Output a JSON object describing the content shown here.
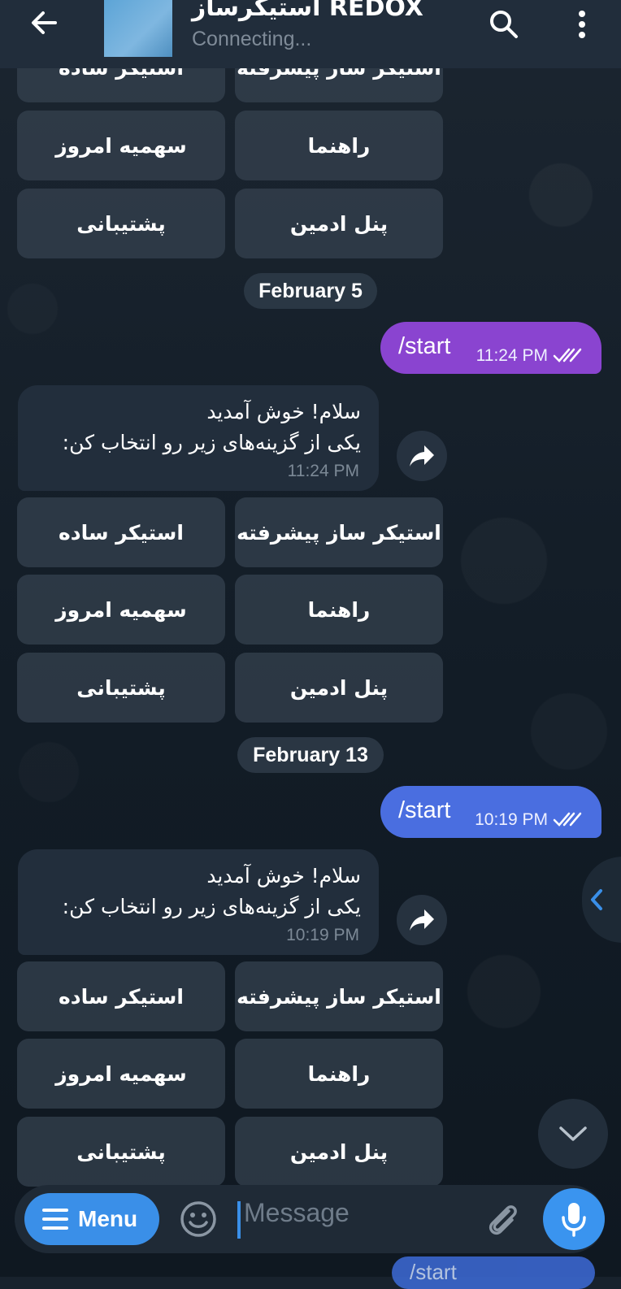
{
  "header": {
    "title": "استیکرساز REDOX",
    "status": "Connecting..."
  },
  "keyboard": {
    "advanced": "استیکر ساز پیشرفته",
    "simple": "استیکر ساده",
    "guide": "راهنما",
    "quota": "سهمیه امروز",
    "admin": "پنل ادمین",
    "support": "پشتیبانی"
  },
  "dates": [
    "February 5",
    "February 13"
  ],
  "messages": [
    {
      "text": "/start",
      "time": "11:24 PM",
      "color": "#8a44d0"
    },
    {
      "line1": "سلام! خوش آمدید",
      "line2": "یکی از گزینه‌های زیر رو انتخاب کن:",
      "time": "11:24 PM"
    },
    {
      "text": "/start",
      "time": "10:19 PM",
      "color": "#4a6ee0"
    },
    {
      "line1": "سلام! خوش آمدید",
      "line2": "یکی از گزینه‌های زیر رو انتخاب کن:",
      "time": "10:19 PM"
    }
  ],
  "bottom_peek": "/start",
  "composer": {
    "menu_label": "Menu",
    "placeholder": "Message"
  },
  "colors": {
    "accent": "#3a8fe8",
    "header_bg": "#212d3b",
    "incoming_bubble": "#222e3c"
  },
  "icons": [
    "back-arrow-icon",
    "search-icon",
    "more-vertical-icon",
    "share-icon",
    "chevron-left-icon",
    "chevron-down-icon",
    "menu-icon",
    "emoji-icon",
    "attach-icon",
    "mic-icon",
    "double-check-icon"
  ]
}
